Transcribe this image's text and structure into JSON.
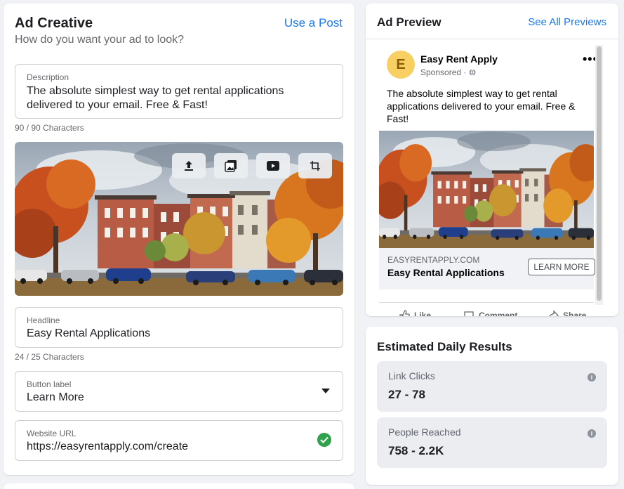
{
  "ad_creative": {
    "title": "Ad Creative",
    "use_post_link": "Use a Post",
    "subtitle": "How do you want your ad to look?",
    "description": {
      "label": "Description",
      "value": "The absolute simplest way to get rental applications delivered to your email. Free & Fast!",
      "counter": "90 / 90 Characters"
    },
    "image_toolbar": [
      "upload-icon",
      "image-library-icon",
      "video-icon",
      "crop-icon"
    ],
    "headline": {
      "label": "Headline",
      "value": "Easy Rental Applications",
      "counter": "24 / 25 Characters"
    },
    "button_label": {
      "label": "Button label",
      "value": "Learn More"
    },
    "website_url": {
      "label": "Website URL",
      "value": "https://easyrentapply.com/create",
      "status_color": "#31a24c"
    }
  },
  "ad_preview": {
    "title": "Ad Preview",
    "see_all_link": "See All Previews",
    "page_name": "Easy Rent Apply",
    "avatar_letter": "E",
    "sponsored": "Sponsored ·",
    "more_menu": "•••",
    "post_text": "The absolute simplest way to get rental applications delivered to your email. Free & Fast!",
    "link_domain": "EASYRENTAPPLY.COM",
    "link_headline": "Easy Rental Applications",
    "cta": "LEARN MORE",
    "actions": [
      "Like",
      "Comment",
      "Share"
    ]
  },
  "estimated_results": {
    "title": "Estimated Daily Results",
    "metrics": [
      {
        "label": "Link Clicks",
        "value": "27 - 78"
      },
      {
        "label": "People Reached",
        "value": "758 - 2.2K"
      }
    ]
  },
  "colors": {
    "accent": "#1877f2",
    "background": "#f0f2f5",
    "success": "#31a24c"
  }
}
